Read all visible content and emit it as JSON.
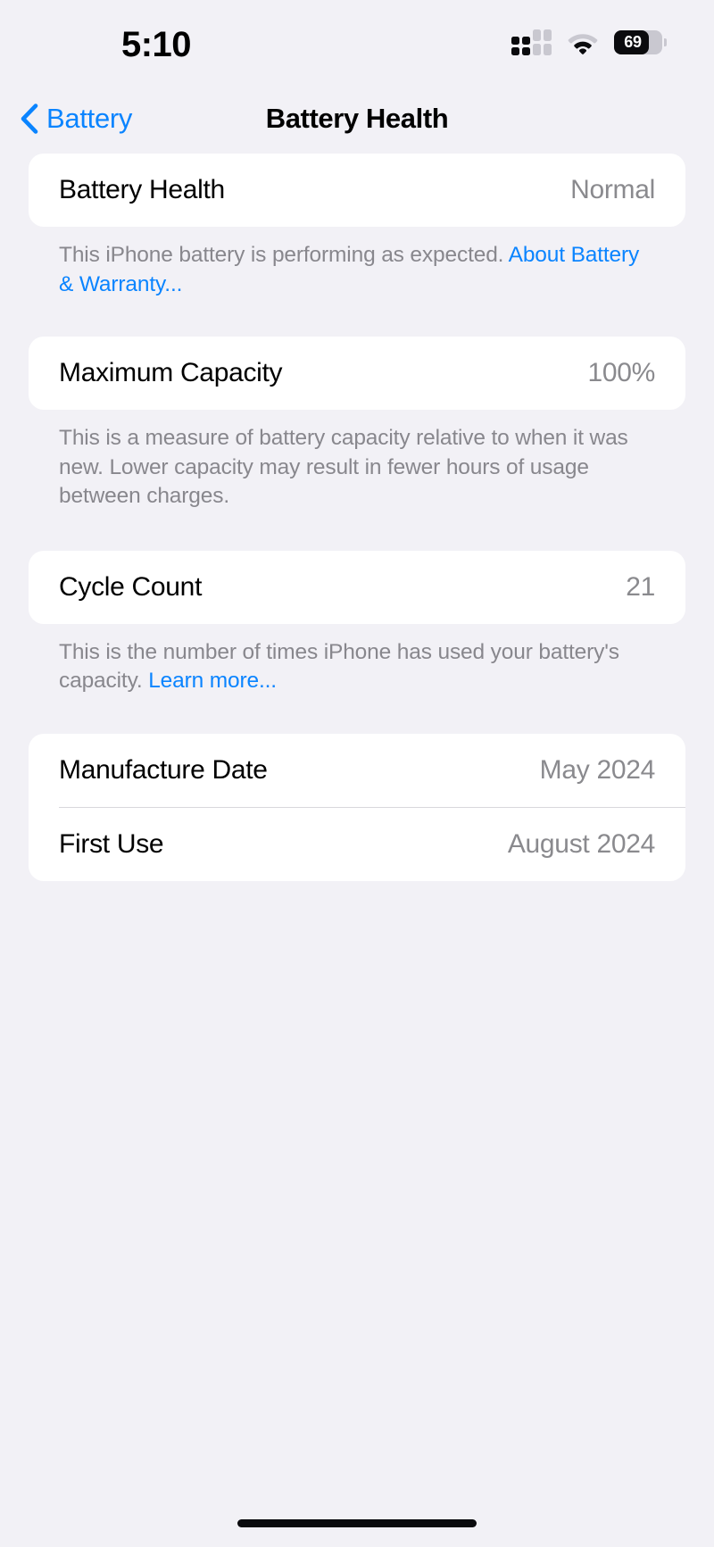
{
  "status_bar": {
    "time": "5:10",
    "cellular_icon": "cellular-signal-icon",
    "cellular_bars_active": 2,
    "cellular_bars_total": 4,
    "wifi_icon": "wifi-icon",
    "battery_icon": "battery-icon",
    "battery_percent": "69",
    "battery_level": 69
  },
  "nav": {
    "back_icon": "chevron-left-icon",
    "back_label": "Battery",
    "title": "Battery Health"
  },
  "sections": [
    {
      "rows": [
        {
          "label": "Battery Health",
          "value": "Normal"
        }
      ],
      "footer_text": "This iPhone battery is performing as expected. ",
      "footer_link": "About Battery & Warranty..."
    },
    {
      "rows": [
        {
          "label": "Maximum Capacity",
          "value": "100%"
        }
      ],
      "footer_text": "This is a measure of battery capacity relative to when it was new. Lower capacity may result in fewer hours of usage between charges.",
      "footer_link": ""
    },
    {
      "rows": [
        {
          "label": "Cycle Count",
          "value": "21"
        }
      ],
      "footer_text": "This is the number of times iPhone has used your battery's capacity. ",
      "footer_link": "Learn more..."
    },
    {
      "rows": [
        {
          "label": "Manufacture Date",
          "value": "May 2024"
        },
        {
          "label": "First Use",
          "value": "August 2024"
        }
      ],
      "footer_text": "",
      "footer_link": ""
    }
  ],
  "colors": {
    "background": "#f2f1f6",
    "card": "#ffffff",
    "accent_blue": "#0a84ff",
    "secondary_text": "#8a8a8e",
    "footer_text": "#88878d"
  },
  "home_indicator": "home-indicator"
}
